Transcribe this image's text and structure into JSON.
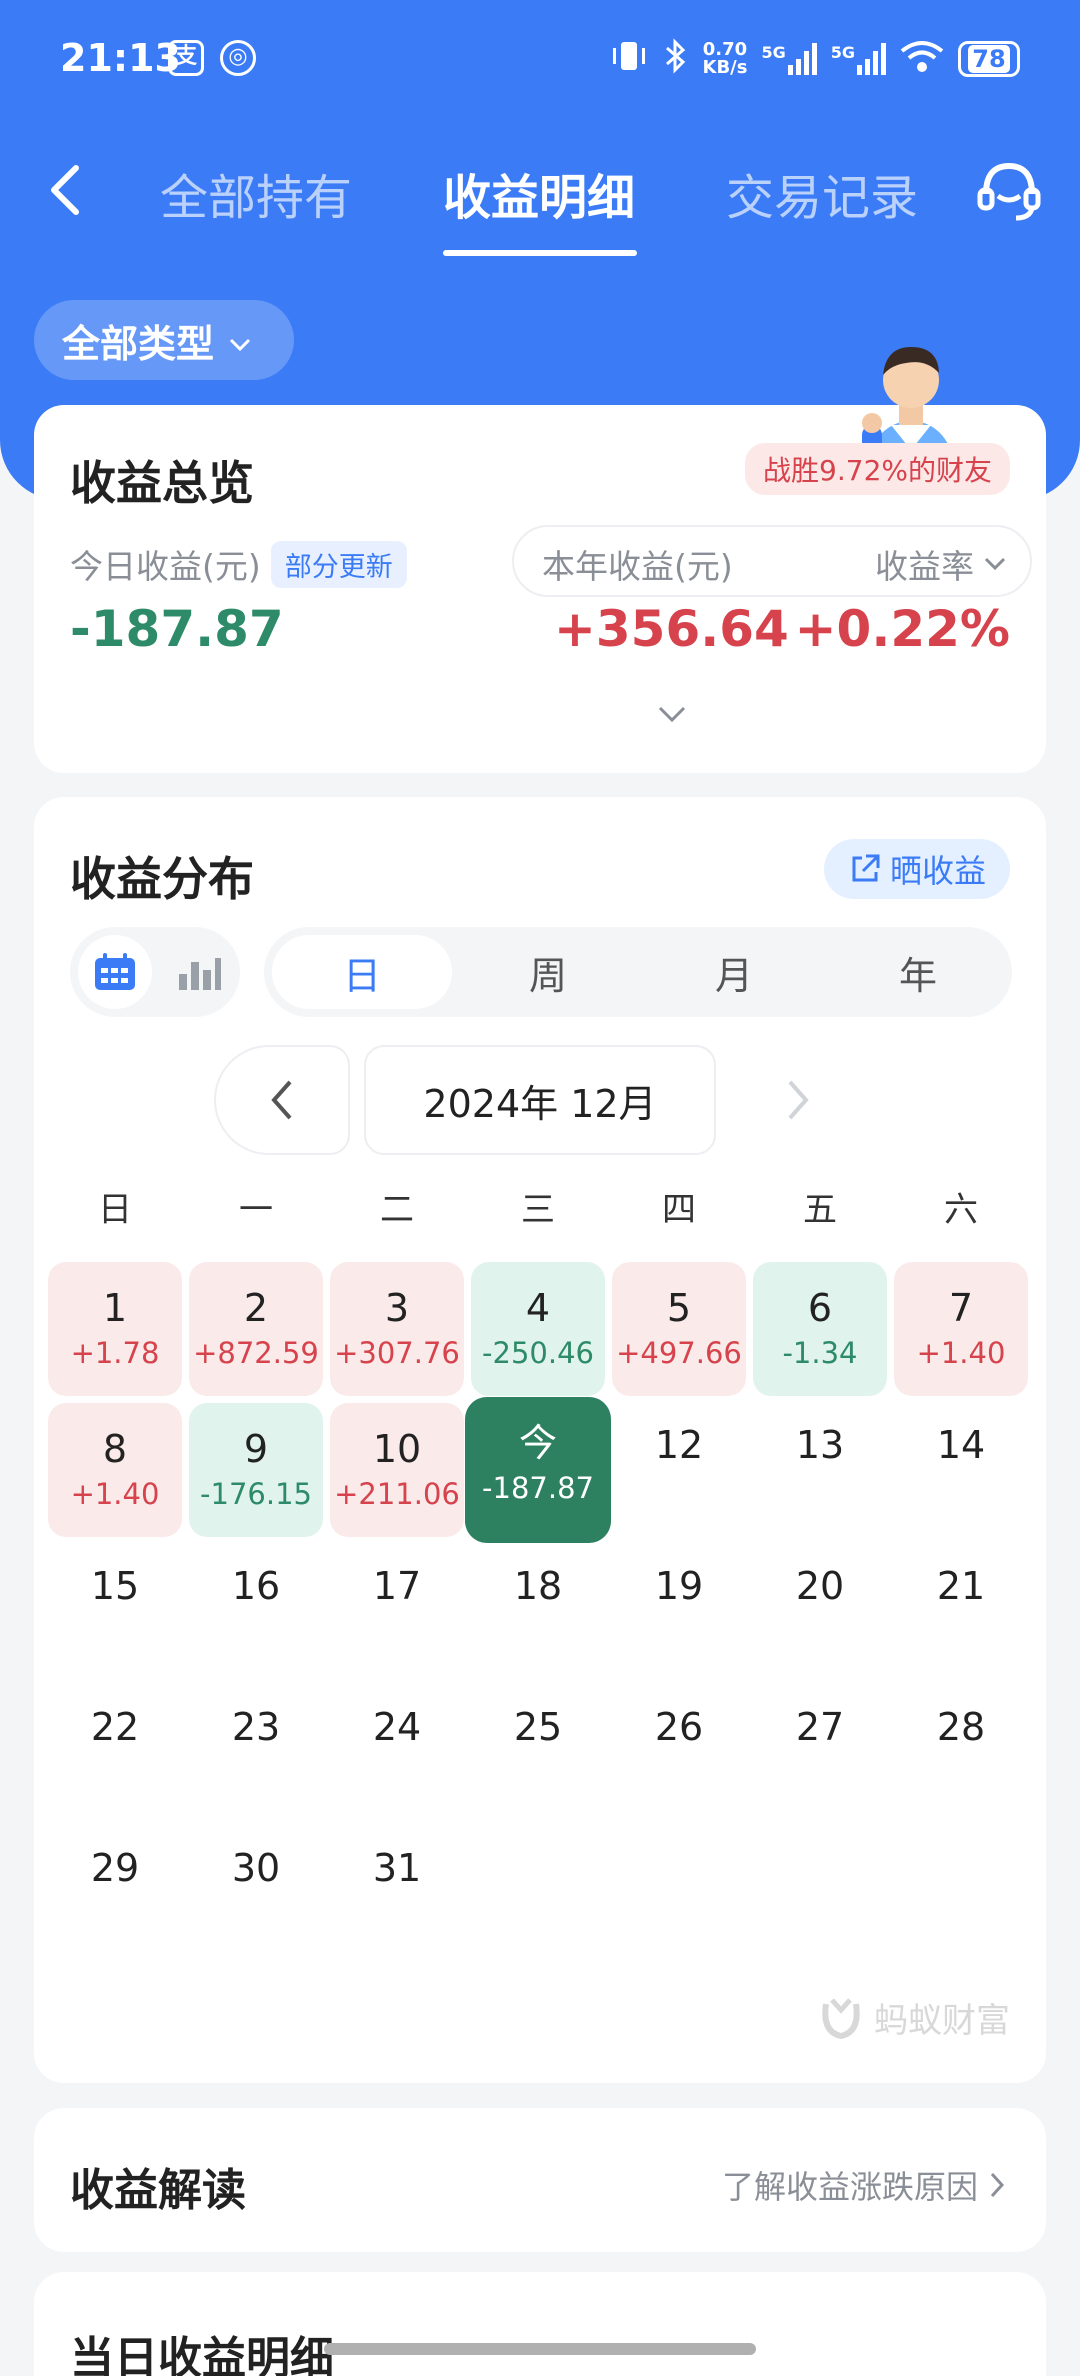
{
  "status_bar": {
    "time": "21:13",
    "net_speed_value": "0.70",
    "net_speed_unit": "KB/s",
    "signal1_label": "5G",
    "signal2_label": "5G",
    "battery": "78"
  },
  "nav": {
    "tabs": [
      "全部持有",
      "收益明细",
      "交易记录"
    ],
    "active_tab": "收益明细"
  },
  "filter": {
    "type_label": "全部类型"
  },
  "overview": {
    "title": "收益总览",
    "beat_badge": "战胜9.72%的财友",
    "today_label": "今日收益(元)",
    "partial_update": "部分更新",
    "today_value": "-187.87",
    "year_label": "本年收益(元)",
    "rate_label": "收益率",
    "year_value": "+356.64",
    "rate_value": "+0.22%"
  },
  "distribution": {
    "title": "收益分布",
    "share_label": "晒收益",
    "period_tabs": [
      "日",
      "周",
      "月",
      "年"
    ],
    "active_period": "日",
    "month_label": "2024年 12月",
    "weekdays": [
      "日",
      "一",
      "二",
      "三",
      "四",
      "五",
      "六"
    ],
    "days": [
      {
        "d": "1",
        "v": "+1.78",
        "s": "up"
      },
      {
        "d": "2",
        "v": "+872.59",
        "s": "up"
      },
      {
        "d": "3",
        "v": "+307.76",
        "s": "up"
      },
      {
        "d": "4",
        "v": "-250.46",
        "s": "down"
      },
      {
        "d": "5",
        "v": "+497.66",
        "s": "up"
      },
      {
        "d": "6",
        "v": "-1.34",
        "s": "down"
      },
      {
        "d": "7",
        "v": "+1.40",
        "s": "up"
      },
      {
        "d": "8",
        "v": "+1.40",
        "s": "up"
      },
      {
        "d": "9",
        "v": "-176.15",
        "s": "down"
      },
      {
        "d": "10",
        "v": "+211.06",
        "s": "up"
      },
      {
        "d": "今",
        "v": "-187.87",
        "s": "today"
      },
      {
        "d": "12",
        "v": "",
        "s": "plain"
      },
      {
        "d": "13",
        "v": "",
        "s": "plain"
      },
      {
        "d": "14",
        "v": "",
        "s": "plain"
      },
      {
        "d": "15",
        "v": "",
        "s": "plain"
      },
      {
        "d": "16",
        "v": "",
        "s": "plain"
      },
      {
        "d": "17",
        "v": "",
        "s": "plain"
      },
      {
        "d": "18",
        "v": "",
        "s": "plain"
      },
      {
        "d": "19",
        "v": "",
        "s": "plain"
      },
      {
        "d": "20",
        "v": "",
        "s": "plain"
      },
      {
        "d": "21",
        "v": "",
        "s": "plain"
      },
      {
        "d": "22",
        "v": "",
        "s": "plain"
      },
      {
        "d": "23",
        "v": "",
        "s": "plain"
      },
      {
        "d": "24",
        "v": "",
        "s": "plain"
      },
      {
        "d": "25",
        "v": "",
        "s": "plain"
      },
      {
        "d": "26",
        "v": "",
        "s": "plain"
      },
      {
        "d": "27",
        "v": "",
        "s": "plain"
      },
      {
        "d": "28",
        "v": "",
        "s": "plain"
      },
      {
        "d": "29",
        "v": "",
        "s": "plain"
      },
      {
        "d": "30",
        "v": "",
        "s": "plain"
      },
      {
        "d": "31",
        "v": "",
        "s": "plain"
      }
    ],
    "watermark": "蚂蚁财富"
  },
  "interpretation": {
    "title": "收益解读",
    "link": "了解收益涨跌原因"
  },
  "next_section": {
    "title": "当日收益明细"
  },
  "colors": {
    "brand_blue": "#3b7cf6",
    "gain_red": "#d6434c",
    "loss_green": "#2e8b6a"
  }
}
